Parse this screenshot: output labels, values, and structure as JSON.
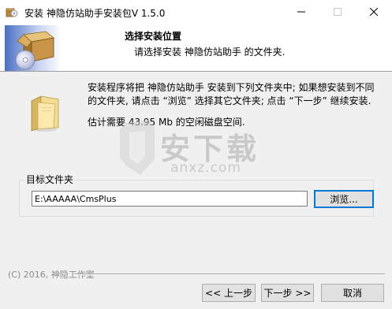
{
  "window": {
    "title": "安装 神隐仿站助手安装包V 1.5.0"
  },
  "header": {
    "title": "选择安装位置",
    "subtitle": "请选择安装 神隐仿站助手 的文件夹."
  },
  "body": {
    "description": "安装程序将把 神隐仿站助手 安装到下列文件夹中; 如果想安装到不同的文件夹, 请点击 “浏览” 选择其它文件夹; 点击 “下一步” 继续安装.",
    "space_required": "估计需要 43.95 Mb 的空闲磁盘空间."
  },
  "target_folder": {
    "group_label": "目标文件夹",
    "path": "E:\\AAAAA\\CmsPlus",
    "browse_label": "浏览..."
  },
  "footer": {
    "copyright": "(C) 2016, 神隐工作室",
    "back_label": "<< 上一步",
    "next_label": "下一步 >>",
    "cancel_label": "取消"
  },
  "watermark": {
    "text": "安下载",
    "sub": "anxz.com"
  },
  "icons": {
    "app": "installer-package-icon",
    "header": "cd-box-icon",
    "folder": "folder-icon"
  },
  "colors": {
    "accent": "#0078d7",
    "title_bar": "#ffffff",
    "dialog_bg": "#f0f0f0",
    "button_bg": "#e1e1e1"
  }
}
